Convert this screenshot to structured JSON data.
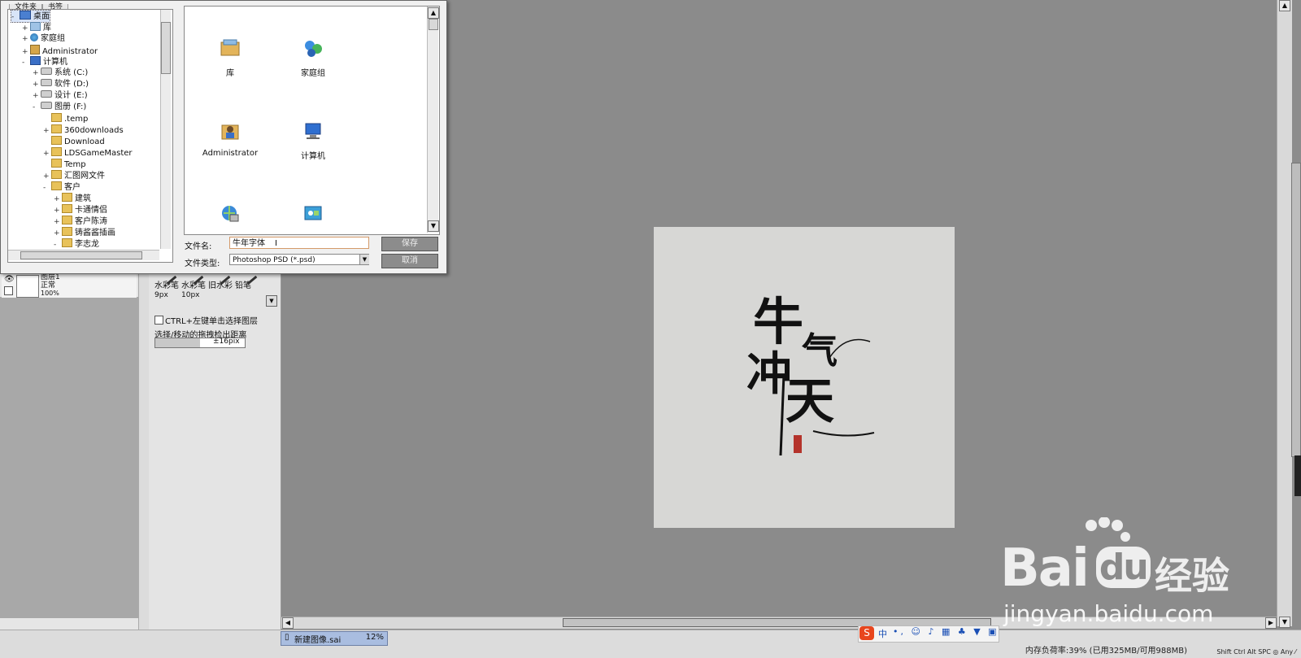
{
  "dialog": {
    "tabs": [
      "文件夹",
      "书签"
    ],
    "tree": [
      {
        "label": "桌面",
        "expander": "-",
        "icon": "desktop",
        "depth": 0,
        "selected": true
      },
      {
        "label": "库",
        "expander": "+",
        "icon": "library",
        "depth": 1
      },
      {
        "label": "家庭组",
        "expander": "+",
        "icon": "network",
        "depth": 1
      },
      {
        "label": "Administrator",
        "expander": "+",
        "icon": "user",
        "depth": 1
      },
      {
        "label": "计算机",
        "expander": "-",
        "icon": "computer",
        "depth": 1
      },
      {
        "label": "系统 (C:)",
        "expander": "+",
        "icon": "drive",
        "depth": 2
      },
      {
        "label": "软件 (D:)",
        "expander": "+",
        "icon": "drive",
        "depth": 2
      },
      {
        "label": "设计 (E:)",
        "expander": "+",
        "icon": "drive",
        "depth": 2
      },
      {
        "label": "图册 (F:)",
        "expander": "-",
        "icon": "drive",
        "depth": 2
      },
      {
        "label": ".temp",
        "expander": "",
        "icon": "folder",
        "depth": 3
      },
      {
        "label": "360downloads",
        "expander": "+",
        "icon": "folder",
        "depth": 3
      },
      {
        "label": "Download",
        "expander": "",
        "icon": "folder",
        "depth": 3
      },
      {
        "label": "LDSGameMaster",
        "expander": "+",
        "icon": "folder",
        "depth": 3
      },
      {
        "label": "Temp",
        "expander": "",
        "icon": "folder",
        "depth": 3
      },
      {
        "label": "汇图网文件",
        "expander": "+",
        "icon": "folder",
        "depth": 3
      },
      {
        "label": "客户",
        "expander": "-",
        "icon": "folder",
        "depth": 3
      },
      {
        "label": "建筑",
        "expander": "+",
        "icon": "folder",
        "depth": 4
      },
      {
        "label": "卡通情侣",
        "expander": "+",
        "icon": "folder",
        "depth": 4
      },
      {
        "label": "客户陈涛",
        "expander": "+",
        "icon": "folder",
        "depth": 4
      },
      {
        "label": "铸酱酱插画",
        "expander": "+",
        "icon": "folder",
        "depth": 4
      },
      {
        "label": "李志龙",
        "expander": "-",
        "icon": "folder",
        "depth": 4
      }
    ],
    "grid_items": [
      {
        "label": "库",
        "icon": "library"
      },
      {
        "label": "家庭组",
        "icon": "network"
      },
      {
        "label": "Administrator",
        "icon": "user"
      },
      {
        "label": "计算机",
        "icon": "computer"
      },
      {
        "label": "",
        "icon": "network-globe"
      },
      {
        "label": "",
        "icon": "control-panel"
      }
    ],
    "filename_label": "文件名:",
    "filename_value": "牛年字体",
    "filetype_label": "文件类型:",
    "filetype_value": "Photoshop PSD (*.psd)",
    "save_label": "保存",
    "cancel_label": "取消"
  },
  "layers": {
    "name": "图层1",
    "mode": "正常",
    "opacity": "100%"
  },
  "tools": {
    "brushes": [
      {
        "name": "水彩笔",
        "size": "9px"
      },
      {
        "name": "水彩笔",
        "size": "10px"
      },
      {
        "name": "旧水彩",
        "size": ""
      },
      {
        "name": "铅笔",
        "size": ""
      }
    ],
    "ctrl_select_label": "CTRL+左键单击选择图层",
    "select_move_label": "选择/移动的拖拽检出距离",
    "select_move_value": "±16pix",
    "select_move_fraction": 0.5
  },
  "status": {
    "document_tab": "新建图像.sai",
    "document_zoom": "12%",
    "memory": "内存负荷率:39% (已用325MB/可用988MB)",
    "keys": "Shift Ctrl Alt SPC ◎ Any ⁄"
  },
  "artwork": {
    "chars": [
      "牛",
      "气",
      "冲",
      "天"
    ]
  },
  "ime": {
    "logo": "S",
    "mode": "中",
    "icons": "•, ☺ ♪ ▦ ♣ ▼ ▣"
  },
  "watermark": {
    "brand": "Bai",
    "brand_du": "du",
    "cn": "经验",
    "url": "jingyan.baidu.com"
  },
  "colors": {
    "canvas_bg": "#8b8b8b",
    "artboard": "#d7d7d5",
    "seal": "#b4332b",
    "ime_logo": "#e8461e",
    "doc_tab": "#a9bde0"
  }
}
